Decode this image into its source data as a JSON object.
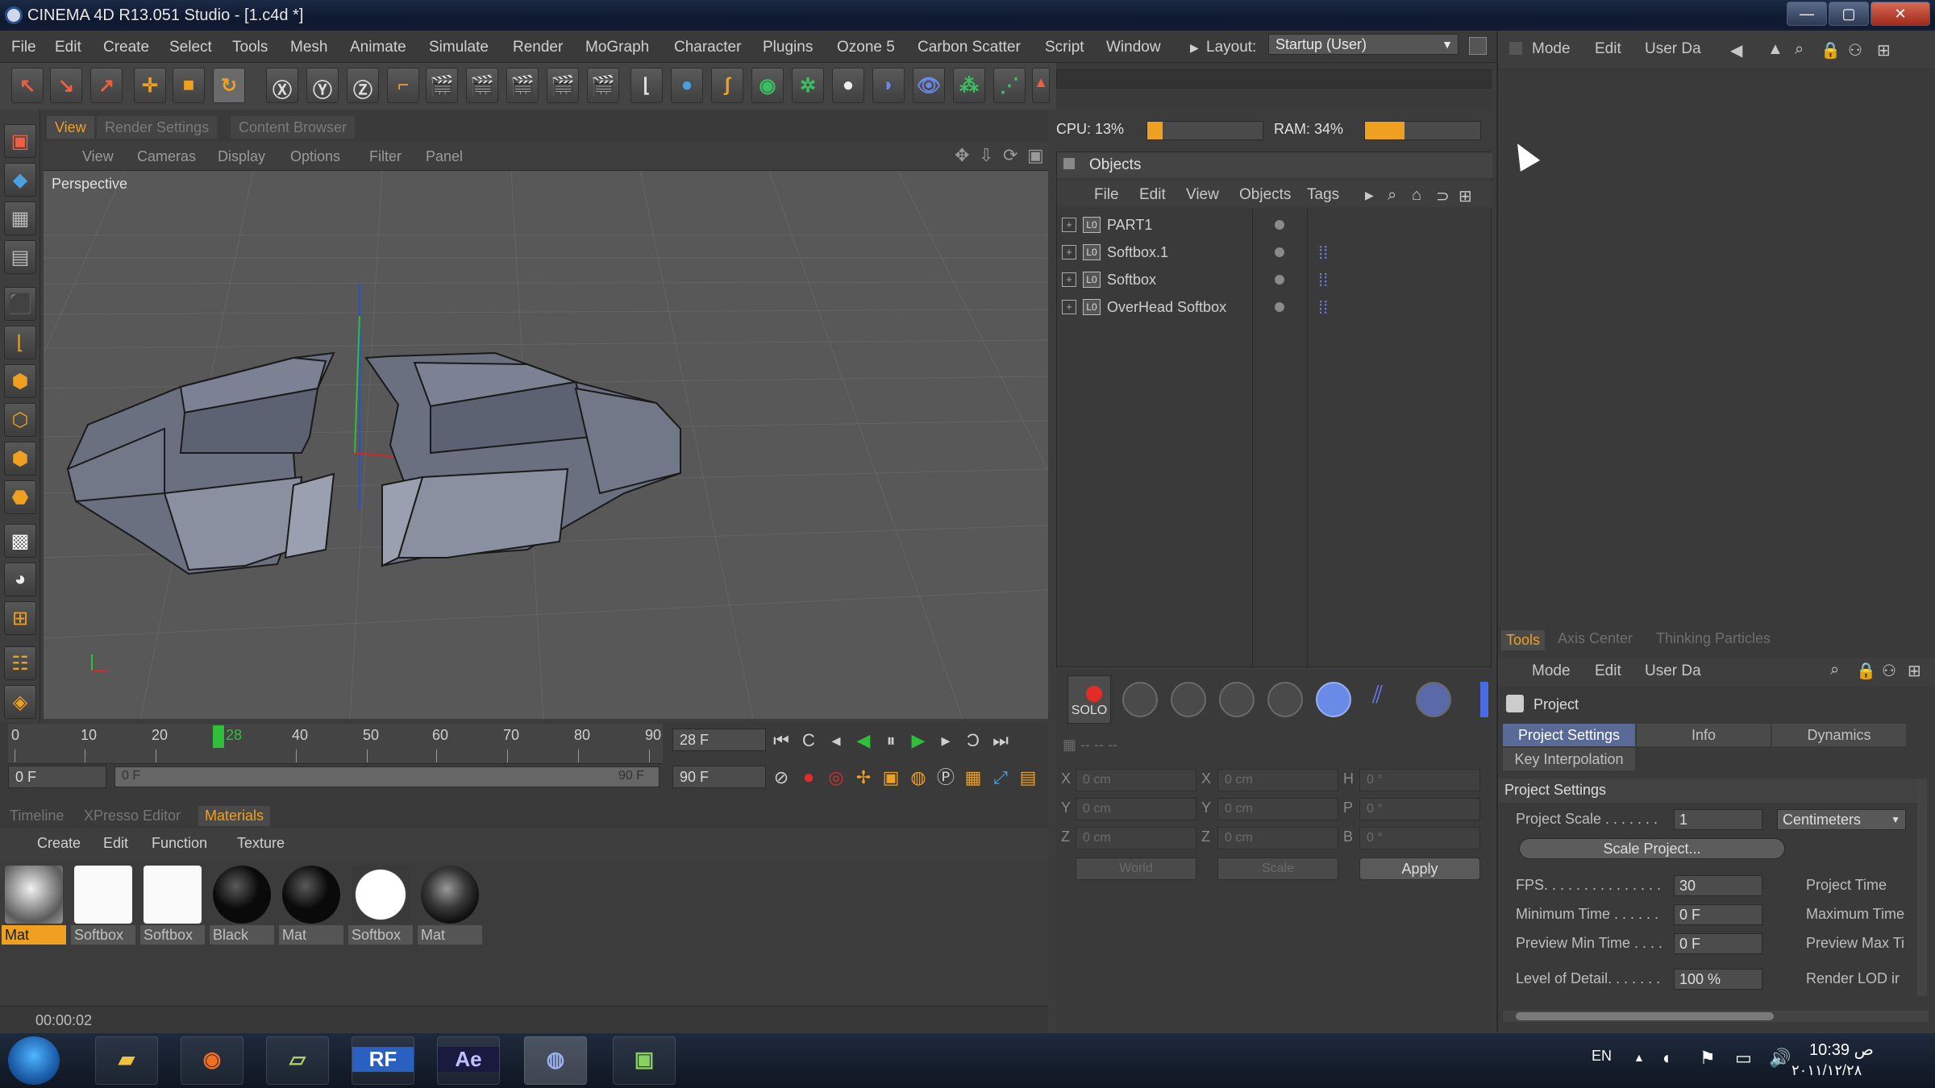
{
  "window": {
    "title": "CINEMA 4D R13.051 Studio - [1.c4d *]"
  },
  "menu": {
    "items": [
      "File",
      "Edit",
      "Create",
      "Select",
      "Tools",
      "Mesh",
      "Animate",
      "Simulate",
      "Render",
      "MoGraph",
      "Character",
      "Plugins",
      "Ozone 5",
      "Carbon Scatter",
      "Script",
      "Window"
    ],
    "layout_label": "Layout:",
    "layout_value": "Startup (User)"
  },
  "view_tabs": [
    "View",
    "Render Settings",
    "Content Browser"
  ],
  "viewport": {
    "menu": [
      "View",
      "Cameras",
      "Display",
      "Options",
      "Filter",
      "Panel"
    ],
    "label": "Perspective"
  },
  "timeline": {
    "ticks": [
      "0",
      "10",
      "20",
      "28",
      "40",
      "50",
      "60",
      "70",
      "80",
      "90"
    ],
    "current_frame": "28 F",
    "start_field": "0 F",
    "end_field": "90 F",
    "range_start": "0 F",
    "range_end": "90 F"
  },
  "materials": {
    "tabs": [
      "Timeline",
      "XPresso Editor",
      "Materials"
    ],
    "menu": [
      "Create",
      "Edit",
      "Function",
      "Texture"
    ],
    "items": [
      {
        "label": "Mat",
        "style": "chrome"
      },
      {
        "label": "Softbox",
        "style": "white"
      },
      {
        "label": "Softbox",
        "style": "white"
      },
      {
        "label": "Black",
        "style": "black"
      },
      {
        "label": "Mat",
        "style": "black"
      },
      {
        "label": "Softbox",
        "style": "white-sphere"
      },
      {
        "label": "Mat",
        "style": "dark-chrome"
      }
    ]
  },
  "status": {
    "time": "00:00:02"
  },
  "system": {
    "cpu_label": "CPU: 13%",
    "cpu_fraction": 0.13,
    "ram_label": "RAM: 34%",
    "ram_fraction": 0.34
  },
  "objects": {
    "header": "Objects",
    "menu": [
      "File",
      "Edit",
      "View",
      "Objects",
      "Tags"
    ],
    "rows": [
      {
        "name": "PART1",
        "has_tag": false
      },
      {
        "name": "Softbox.1",
        "has_tag": true
      },
      {
        "name": "Softbox",
        "has_tag": true
      },
      {
        "name": "OverHead Softbox",
        "has_tag": true
      }
    ]
  },
  "tools_bar": {
    "solo_label": "SOLO"
  },
  "coords": {
    "rows": [
      {
        "a": "X",
        "a_val": "0 cm",
        "b": "X",
        "b_val": "0 cm",
        "c": "H",
        "c_val": "0 °"
      },
      {
        "a": "Y",
        "a_val": "0 cm",
        "b": "Y",
        "b_val": "0 cm",
        "c": "P",
        "c_val": "0 °"
      },
      {
        "a": "Z",
        "a_val": "0 cm",
        "b": "Z",
        "b_val": "0 cm",
        "c": "B",
        "c_val": "0 °"
      }
    ],
    "world_select": "World",
    "scale_select": "Scale",
    "apply_label": "Apply"
  },
  "right_panel_menu": [
    "Mode",
    "Edit",
    "User Da"
  ],
  "attributes": {
    "tabs": [
      "Tools",
      "Axis Center",
      "Thinking Particles"
    ],
    "menu": [
      "Mode",
      "Edit",
      "User Da"
    ],
    "title": "Project",
    "project_tabs": [
      "Project Settings",
      "Info",
      "Dynamics"
    ],
    "key_interp": "Key Interpolation",
    "section": "Project Settings",
    "project_scale_label": "Project Scale . . . . . . .",
    "project_scale_value": "1",
    "project_scale_unit": "Centimeters",
    "scale_project_button": "Scale Project...",
    "fps_label": "FPS. . . . . . . . . . . . . . .",
    "fps_value": "30",
    "project_time_label": "Project Time",
    "min_time_label": "Minimum Time . . . . . .",
    "min_time_value": "0 F",
    "max_time_label": "Maximum Time",
    "preview_min_label": "Preview Min Time . . . .",
    "preview_min_value": "0 F",
    "preview_max_label": "Preview Max Ti",
    "lod_label": "Level of Detail. . . . . . .",
    "lod_value": "100 %",
    "render_lod_label": "Render LOD ir"
  },
  "taskbar": {
    "lang": "EN",
    "time": "10:39 ص",
    "date": "٢٠١١/١٢/٢٨"
  }
}
